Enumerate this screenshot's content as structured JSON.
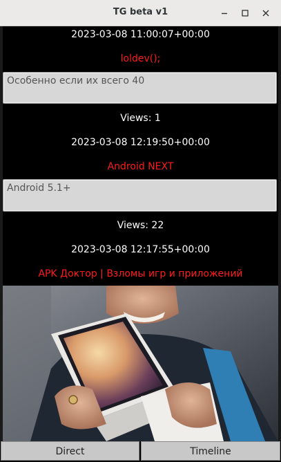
{
  "window": {
    "title": "TG beta v1"
  },
  "posts": [
    {
      "timestamp": "2023-03-08 11:00:07+00:00",
      "channel": "loldev();",
      "text": "Особенно если их всего 40",
      "views_label": "Views: 1"
    },
    {
      "timestamp": "2023-03-08 12:19:50+00:00",
      "channel": "Android NEXT",
      "text": "Android 5.1+",
      "views_label": "Views: 22"
    },
    {
      "timestamp": "2023-03-08 12:17:55+00:00",
      "channel": "APK Доктор | Взломы игр и приложений",
      "image": "photo of smiling man holding iPhone XS box"
    }
  ],
  "tabs": {
    "direct": "Direct",
    "timeline": "Timeline"
  },
  "colors": {
    "channel": "#ff1a1a",
    "background": "#000000",
    "titlebar": "#eceae8"
  }
}
